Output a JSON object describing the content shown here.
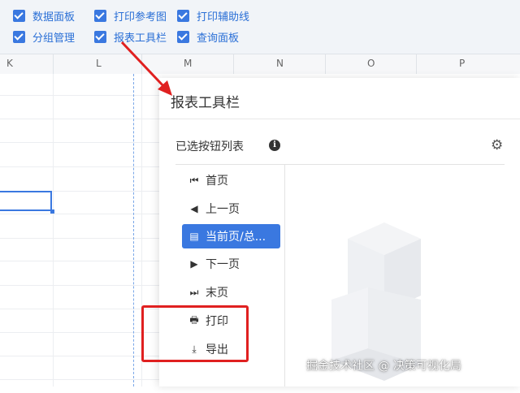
{
  "view_options": [
    {
      "label": "数据面板",
      "checked": true
    },
    {
      "label": "打印参考图",
      "checked": true
    },
    {
      "label": "打印辅助线",
      "checked": true
    },
    {
      "label": "分组管理",
      "checked": true
    },
    {
      "label": "报表工具栏",
      "checked": true
    },
    {
      "label": "查询面板",
      "checked": true
    }
  ],
  "columns": [
    "K",
    "L",
    "M",
    "N",
    "O",
    "P"
  ],
  "panel": {
    "title": "报表工具栏",
    "list_heading": "已选按钮列表",
    "info_icon": "i",
    "settings_icon": "gear-icon",
    "buttons": [
      {
        "label": "首页",
        "icon": "first-page-icon",
        "glyph": "⏮"
      },
      {
        "label": "上一页",
        "icon": "prev-page-icon",
        "glyph": "◀"
      },
      {
        "label": "当前页/总...",
        "icon": "page-icon",
        "glyph": "▤",
        "active": true
      },
      {
        "label": "下一页",
        "icon": "next-page-icon",
        "glyph": "▶"
      },
      {
        "label": "末页",
        "icon": "last-page-icon",
        "glyph": "⏭"
      },
      {
        "label": "打印",
        "icon": "print-icon",
        "glyph": "🖶"
      },
      {
        "label": "导出",
        "icon": "export-icon",
        "glyph": "⤓"
      }
    ]
  },
  "colors": {
    "accent": "#3a78e0",
    "highlight": "#e02020"
  },
  "watermark": "掘金技术社区 @ 决策可视化局"
}
